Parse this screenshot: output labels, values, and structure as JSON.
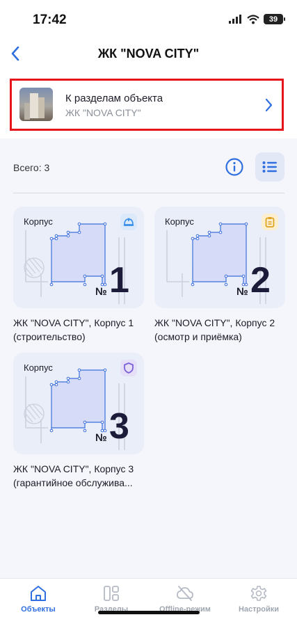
{
  "status_bar": {
    "time": "17:42",
    "battery": "39"
  },
  "navbar": {
    "title": "ЖК \"NOVA CITY\""
  },
  "object_link": {
    "title": "К разделам объекта",
    "subtitle": "ЖК \"NOVA CITY\""
  },
  "summary": {
    "total_label": "Всего: 3"
  },
  "colors": {
    "accent": "#2f6fe0",
    "highlight": "#e8141c",
    "card_bg": "#eaeef8",
    "plan_fill": "#d6dcf8"
  },
  "buildings": [
    {
      "label": "Корпус",
      "numsign": "№",
      "number": "1",
      "caption": "ЖК \"NOVA CITY\", Корпус 1 (строительство)",
      "status_icon": "helmet-icon",
      "status_color": "#3a8ee8",
      "status_bg": "#dbe9fb"
    },
    {
      "label": "Корпус",
      "numsign": "№",
      "number": "2",
      "caption": "ЖК \"NOVA CITY\", Корпус 2 (осмотр и приёмка)",
      "status_icon": "clipboard-icon",
      "status_color": "#e0a020",
      "status_bg": "#fbefcf"
    },
    {
      "label": "Корпус",
      "numsign": "№",
      "number": "3",
      "caption": "ЖК \"NOVA CITY\", Корпус 3 (гарантийное обслужива...",
      "status_icon": "shield-icon",
      "status_color": "#7a5fd6",
      "status_bg": "#e5dff8"
    }
  ],
  "tabs": [
    {
      "label": "Объекты",
      "icon": "home-icon",
      "active": true
    },
    {
      "label": "Разделы",
      "icon": "sections-icon",
      "active": false
    },
    {
      "label": "Offline-режим",
      "icon": "cloud-off-icon",
      "active": false
    },
    {
      "label": "Настройки",
      "icon": "gear-icon",
      "active": false
    }
  ]
}
